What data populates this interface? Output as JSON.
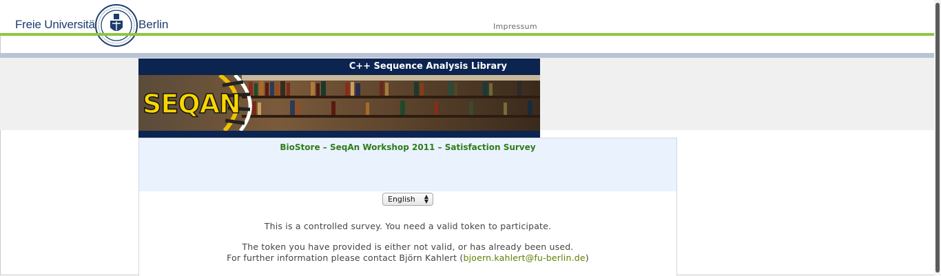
{
  "header": {
    "brand_left": "Freie Universität",
    "brand_right": "Berlin",
    "impressum": "Impressum"
  },
  "banner": {
    "title": "C++ Sequence Analysis Library",
    "logo_text": "SEQAN"
  },
  "survey": {
    "title": "BioStore – SeqAn Workshop 2011 – Satisfaction Survey",
    "language": "English",
    "message_controlled": "This is a controlled survey. You need a valid token to participate.",
    "message_token": "The token you have provided is either not valid, or has already been used.",
    "contact_prefix": "For further information please contact Björn Kahlert (",
    "contact_email": "bjoern.kahlert@fu-berlin.de",
    "contact_suffix": ")"
  },
  "colors": {
    "accent_green": "#8dc63f",
    "title_green": "#2d7d1a",
    "link_green": "#5f7f00",
    "banner_navy": "#0b2450"
  }
}
